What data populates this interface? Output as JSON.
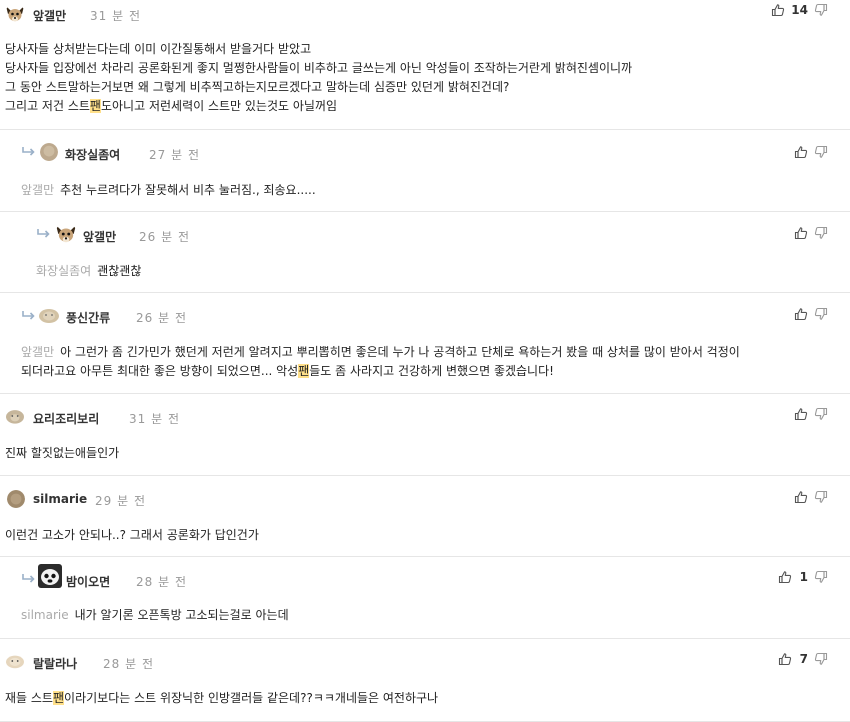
{
  "comments": [
    {
      "id": "c1",
      "nick": "앞갤만",
      "time": "31 분 전",
      "votes": "14",
      "lines": [
        "당사자들 상처받는다는데 이미 이간질통해서 받을거다 받았고",
        "당사자들 입장에선 차라리 공론화된게 좋지 멀쩡한사람들이 비추하고 글쓰는게 아닌 악성들이 조작하는거란게 밝혀진셈이니까",
        "그 동안 스트말하는거보면 왜 그렇게 비추찍고하는지모르겠다고 말하는데 심증만 있던게 밝혀진건데?"
      ],
      "line4_pre": "그리고 저건 스트",
      "line4_hl": "팬",
      "line4_post": "도아니고 저런세력이 스트만 있는것도 아닐꺼임"
    },
    {
      "id": "c2",
      "nick": "화장실좀여",
      "time": "27 분 전",
      "mention": "앞갤만",
      "text": "추천 누르려다가 잘못해서 비추 눌러짐., 죄송요....."
    },
    {
      "id": "c3",
      "nick": "앞갤만",
      "time": "26 분 전",
      "mention": "화장실좀여",
      "text": "괜찮괜찮"
    },
    {
      "id": "c4",
      "nick": "풍신간류",
      "time": "26 분 전",
      "mention": "앞갤만",
      "line1": "아 그런가 좀 긴가민가 했던게 저런게 알려지고 뿌리뽑히면 좋은데 누가 나 공격하고 단체로 욕하는거 봤을 때 상처를 많이 받아서 걱정이",
      "line2_pre": "되더라고요 아무튼 최대한 좋은 방향이 되었으면... 악성",
      "line2_hl": "팬",
      "line2_post": "들도 좀 사라지고 건강하게 변했으면 좋겠습니다!"
    },
    {
      "id": "c5",
      "nick": "요리조리보리",
      "time": "31 분 전",
      "text": "진짜 할짓없는애들인가"
    },
    {
      "id": "c6",
      "nick": "silmarie",
      "time": "29 분 전",
      "text": "이런건 고소가 안되나..? 그래서 공론화가 답인건가"
    },
    {
      "id": "c7",
      "nick": "밤이오면",
      "time": "28 분 전",
      "votes": "1",
      "mention": "silmarie",
      "text": "내가 알기론 오픈톡방 고소되는걸로 아는데"
    },
    {
      "id": "c8",
      "nick": "랄랄라나",
      "time": "28 분 전",
      "votes": "7",
      "pre": "재들 스트",
      "hl": "팬",
      "post": "이라기보다는 스트 위장닉한 인방갤러들 같은데??ㅋㅋ개네들은 여전하구나"
    }
  ],
  "icons": {
    "upvote": "thumbs-up-icon",
    "downvote": "thumbs-down-icon",
    "reply": "reply-arrow-icon"
  },
  "colors": {
    "highlight": "#ffe08a",
    "mention": "#aaaaaa",
    "time": "#999999"
  }
}
